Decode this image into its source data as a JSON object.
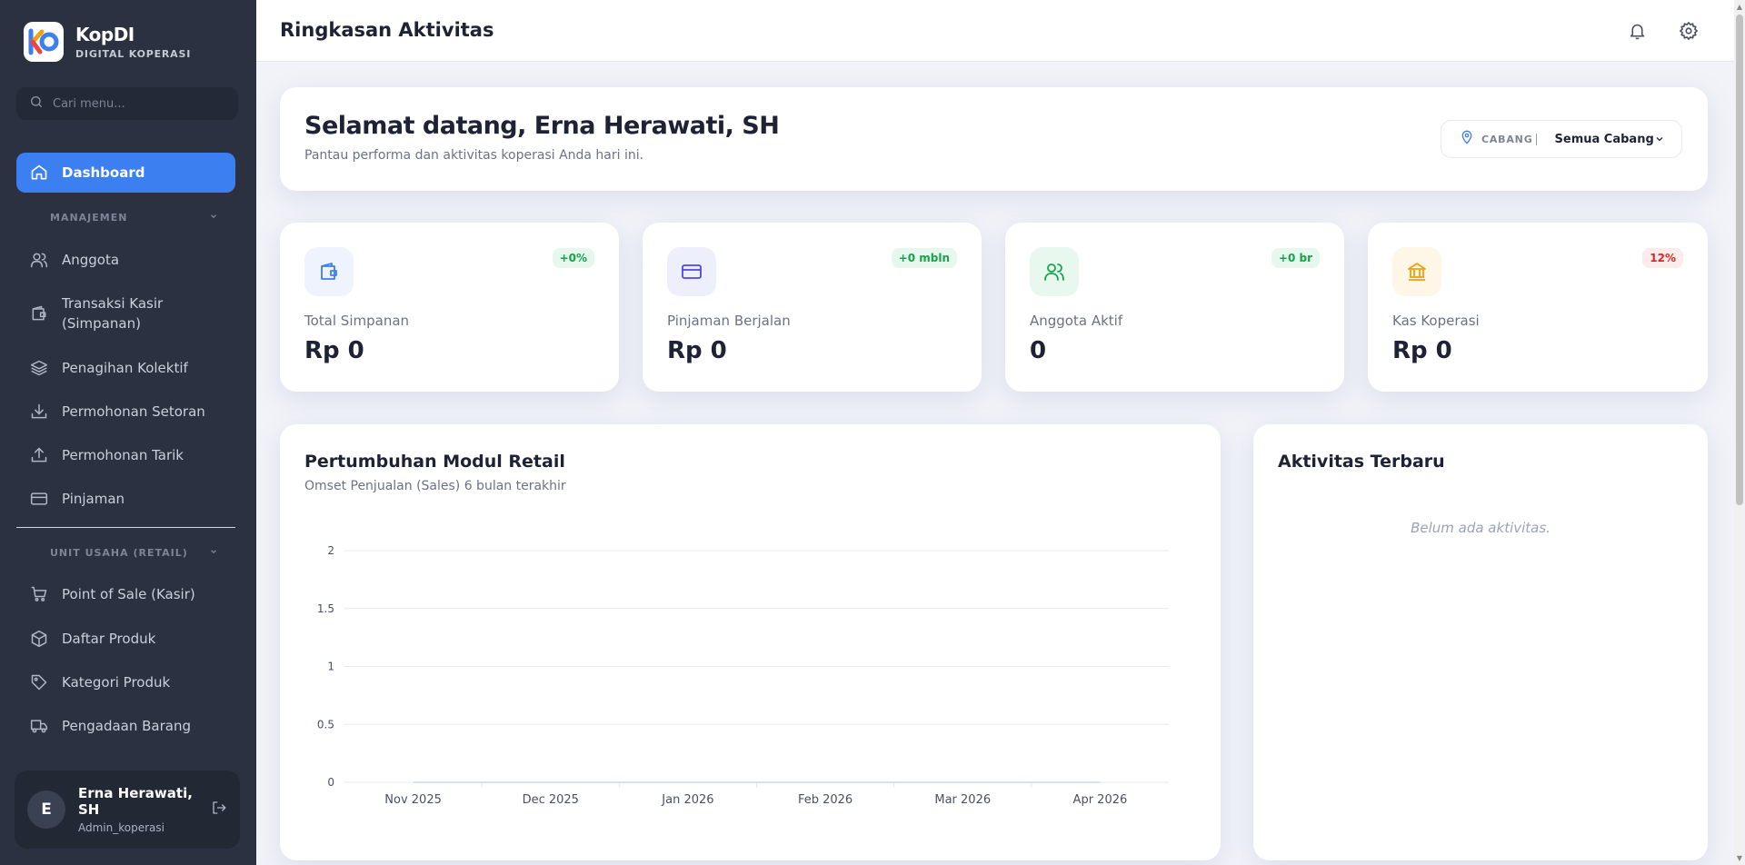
{
  "sidebar": {
    "brand_name": "KopDI",
    "brand_sub": "DIGITAL KOPERASI",
    "search_placeholder": "Cari menu...",
    "dashboard_label": "Dashboard",
    "section_management": "MANAJEMEN",
    "management_items": [
      {
        "label": "Anggota",
        "icon": "users-icon"
      },
      {
        "label": "Transaksi Kasir",
        "label2": "(Simpanan)",
        "icon": "wallet-icon"
      },
      {
        "label": "Penagihan Kolektif",
        "icon": "layers-icon"
      },
      {
        "label": "Permohonan Setoran",
        "icon": "download-icon"
      },
      {
        "label": "Permohonan Tarik",
        "icon": "upload-icon"
      },
      {
        "label": "Pinjaman",
        "icon": "credit-card-icon"
      }
    ],
    "section_retail": "UNIT USAHA (RETAIL)",
    "retail_items": [
      {
        "label": "Point of Sale (Kasir)",
        "icon": "cart-icon"
      },
      {
        "label": "Daftar Produk",
        "icon": "box-icon"
      },
      {
        "label": "Kategori Produk",
        "icon": "tag-icon"
      },
      {
        "label": "Pengadaan Barang",
        "icon": "truck-icon"
      }
    ],
    "user": {
      "initial": "E",
      "name": "Erna Herawati, SH",
      "role": "Admin_koperasi"
    }
  },
  "topbar": {
    "title": "Ringkasan Aktivitas"
  },
  "welcome": {
    "title": "Selamat datang, Erna Herawati, SH",
    "subtitle": "Pantau performa dan aktivitas koperasi Anda hari ini.",
    "branch_label": "CABANG",
    "branch_value": "Semua Cabang"
  },
  "stats": [
    {
      "label": "Total Simpanan",
      "value": "Rp 0",
      "badge": "+0%",
      "badge_color": "#16a34a",
      "badge_bg": "#e6f8ee",
      "icon": "wallet-icon",
      "icon_color": "#3b7ff0",
      "icon_bg": "#eef3fd"
    },
    {
      "label": "Pinjaman Berjalan",
      "value": "Rp 0",
      "badge": "+0 mbln",
      "badge_color": "#16a34a",
      "badge_bg": "#e6f8ee",
      "icon": "credit-card-icon",
      "icon_color": "#4f46e5",
      "icon_bg": "#eeeffd"
    },
    {
      "label": "Anggota Aktif",
      "value": "0",
      "badge": "+0 br",
      "badge_color": "#16a34a",
      "badge_bg": "#e6f8ee",
      "icon": "users-icon",
      "icon_color": "#16a34a",
      "icon_bg": "#e8f8ef"
    },
    {
      "label": "Kas Koperasi",
      "value": "Rp 0",
      "badge": "12%",
      "badge_color": "#dc2626",
      "badge_bg": "#fdecec",
      "icon": "bank-icon",
      "icon_color": "#f59e0b",
      "icon_bg": "#fef6e6"
    }
  ],
  "chart": {
    "title": "Pertumbuhan Modul Retail",
    "subtitle": "Omset Penjualan (Sales) 6 bulan terakhir"
  },
  "chart_data": {
    "type": "line",
    "title": "Pertumbuhan Modul Retail",
    "subtitle": "Omset Penjualan (Sales) 6 bulan terakhir",
    "categories": [
      "Nov 2025",
      "Dec 2025",
      "Jan 2026",
      "Feb 2026",
      "Mar 2026",
      "Apr 2026"
    ],
    "series": [
      {
        "values": [
          0,
          0,
          0,
          0,
          0,
          0
        ]
      }
    ],
    "ylim": [
      0,
      2
    ],
    "yticks": [
      "0",
      "0.5",
      "1",
      "1.5",
      "2"
    ],
    "grid": true,
    "line_color": "#3b7ff0",
    "grid_color": "#e6e8ee"
  },
  "activity": {
    "title": "Aktivitas Terbaru",
    "empty": "Belum ada aktivitas."
  }
}
